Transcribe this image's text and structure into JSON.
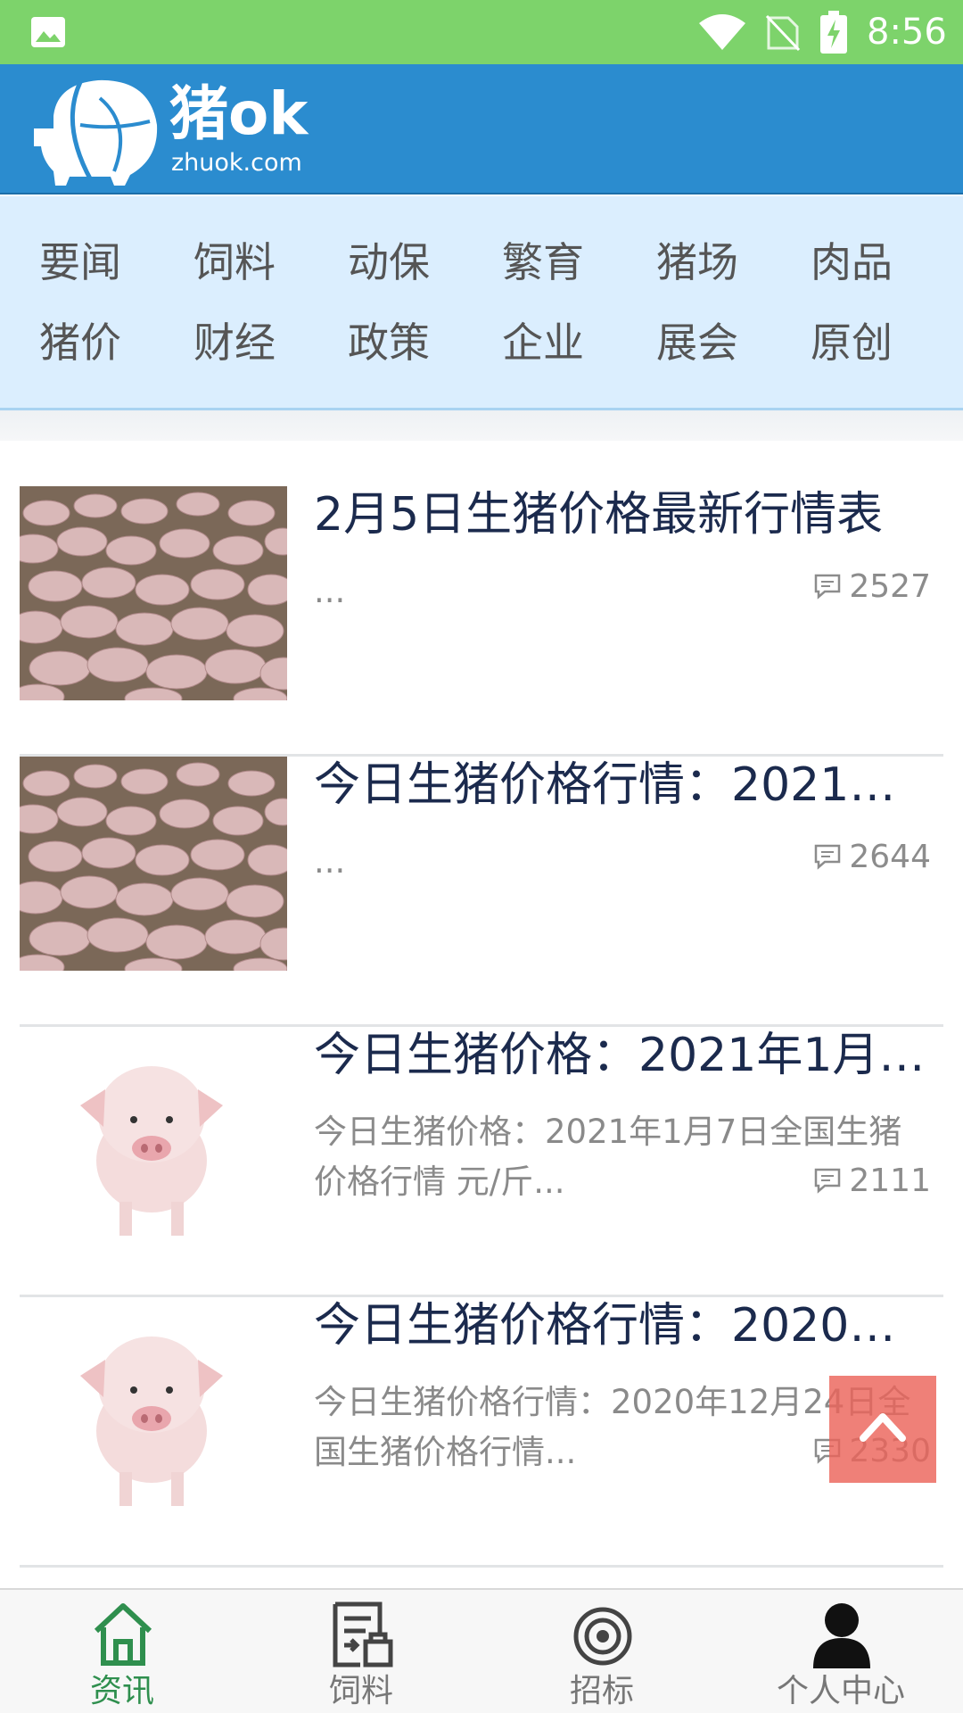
{
  "status_bar": {
    "time": "8:56"
  },
  "header": {
    "brand_name": "猪ok",
    "brand_domain": "zhuok.com"
  },
  "categories": [
    "要闻",
    "饲料",
    "动保",
    "繁育",
    "猪场",
    "肉品",
    "猪价",
    "财经",
    "政策",
    "企业",
    "展会",
    "原创"
  ],
  "articles": [
    {
      "title": "2月5日生猪价格最新行情表",
      "summary": "...",
      "comments": "2527",
      "thumb": "pig-herd-photo"
    },
    {
      "title": "今日生猪价格行情：2021…",
      "summary": "...",
      "comments": "2644",
      "thumb": "pig-herd-photo"
    },
    {
      "title": "今日生猪价格：2021年1月…",
      "summary": "今日生猪价格：2021年1月7日全国生猪价格行情 元/斤...",
      "comments": "2111",
      "thumb": "piglet-photo"
    },
    {
      "title": "今日生猪价格行情：2020…",
      "summary": "今日生猪价格行情：2020年12月24日全国生猪价格行情...",
      "comments": "2330",
      "thumb": "piglet-photo"
    }
  ],
  "tabs": [
    {
      "label": "资讯",
      "icon": "home-icon",
      "active": true
    },
    {
      "label": "饲料",
      "icon": "document-icon",
      "active": false
    },
    {
      "label": "招标",
      "icon": "target-icon",
      "active": false
    },
    {
      "label": "个人中心",
      "icon": "person-icon",
      "active": false
    }
  ],
  "colors": {
    "status_bar": "#7dd36b",
    "header": "#2b8ccf",
    "nav_bg": "#dbeefe",
    "active_tab": "#2f8f4e",
    "back_top": "#eb645a"
  }
}
